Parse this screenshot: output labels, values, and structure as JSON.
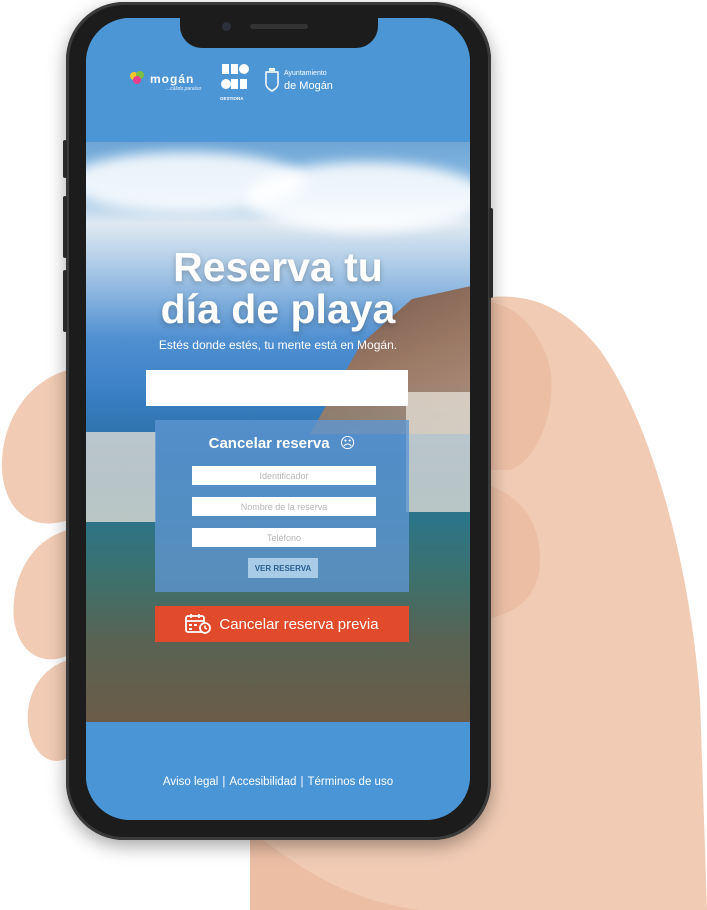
{
  "header": {
    "logo_mogan_text": "mogán",
    "logo_mogan_tag": "...cálido paraíso",
    "logo_gestion_text": "GESTIONA",
    "logo_ayto_line1": "Ayuntamiento",
    "logo_ayto_line2": "de Mogán"
  },
  "hero": {
    "title_line1": "Reserva tu",
    "title_line2": "día de playa",
    "subtitle": "Estés donde estés, tu mente está en Mogán."
  },
  "cancel_card": {
    "title": "Cancelar reserva",
    "sad_icon": "☹",
    "fields": {
      "id_placeholder": "Identificador",
      "name_placeholder": "Nombre de la reserva",
      "phone_placeholder": "Teléfono"
    },
    "view_button": "VER RESERVA"
  },
  "previous_button": "Cancelar reserva previa",
  "footer": {
    "legal": "Aviso legal",
    "sep1": "|",
    "accessibility": "Accesibilidad",
    "sep2": "|",
    "terms": "Términos de uso"
  },
  "colors": {
    "brand_blue": "#4d96d6",
    "cancel_red": "#e14a2a",
    "card_blue": "#5f96d2"
  }
}
